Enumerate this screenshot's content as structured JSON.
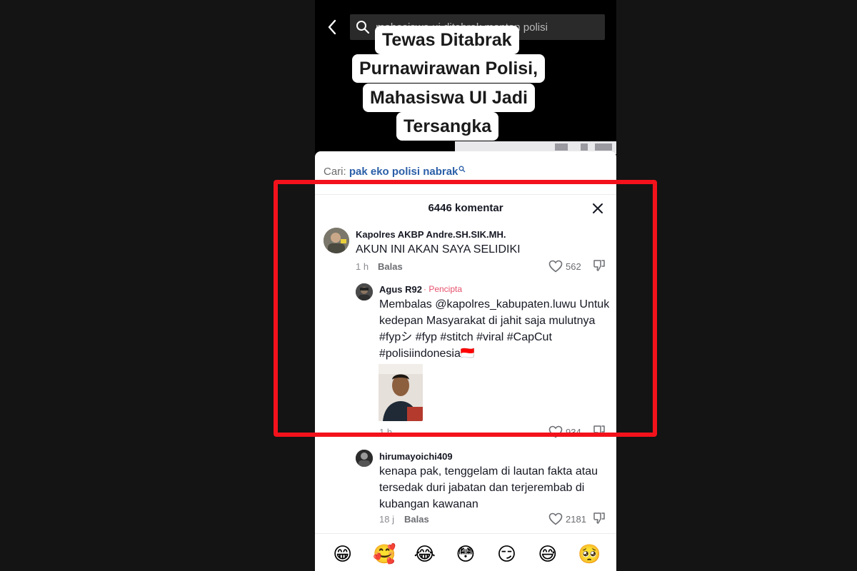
{
  "video": {
    "search_query": "mahasiswa ui ditabrak mantan polisi",
    "caption_lines": [
      "Tewas Ditabrak",
      "Purnawirawan Polisi,",
      "Mahasiswa UI Jadi",
      "Tersangka"
    ]
  },
  "sheet": {
    "search_hint_prefix": "Cari:",
    "search_hint_query": "pak eko polisi nabrak",
    "comment_count": "6446 komentar"
  },
  "comments": [
    {
      "username": "Kapolres AKBP Andre.SH.SIK.MH.",
      "text": "AKUN INI AKAN SAYA SELIDIKI",
      "time": "1 h",
      "reply_label": "Balas",
      "likes": "562"
    },
    {
      "username": "Agus R92",
      "badge": "· Pencipta",
      "text": "Membalas @kapolres_kabupaten.luwu Untuk kedepan Masyarakat di jahit saja mulutnya #fypシ #fyp #stitch #viral #CapCut #polisiindonesia🇮🇩",
      "time": "1 h",
      "likes": "934"
    },
    {
      "username": "hirumayoichi409",
      "text": "kenapa pak, tenggelam di lautan fakta atau tersedak duri jabatan dan terjerembab di kubangan kawanan",
      "time": "18 j",
      "reply_label": "Balas",
      "likes": "2181"
    }
  ],
  "emoji_bar": [
    "😁",
    "🥰",
    "😂",
    "😳",
    "😏",
    "😅",
    "🥺"
  ],
  "colors": {
    "highlight": "#f3121b",
    "creator_badge": "#e5506b",
    "search_hint_query": "#2b5fa8"
  }
}
